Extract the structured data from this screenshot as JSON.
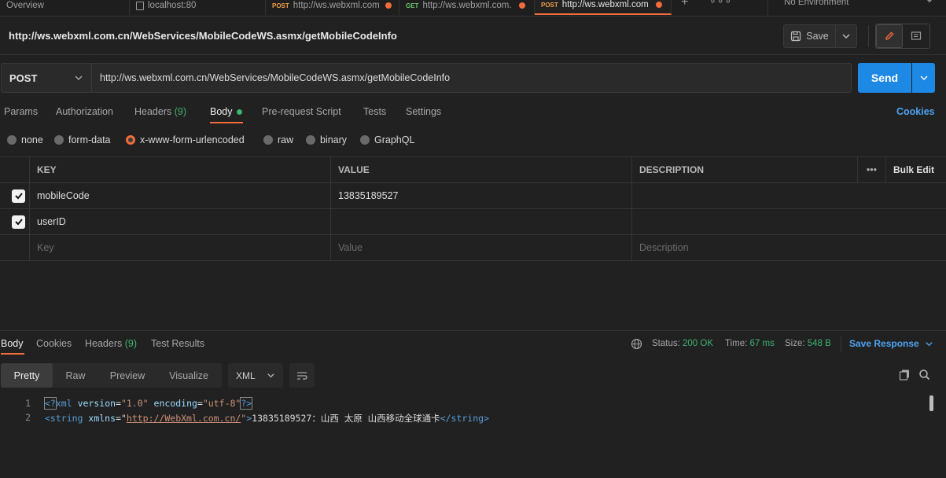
{
  "tabs": [
    {
      "method": "",
      "label": "Overview",
      "dirty": false
    },
    {
      "method": "",
      "label": "localhost:80",
      "dirty": false,
      "icon": "file-icon"
    },
    {
      "method": "POST",
      "label": "http://ws.webxml.com",
      "dirty": true
    },
    {
      "method": "GET",
      "label": "http://ws.webxml.com.",
      "dirty": true
    },
    {
      "method": "POST",
      "label": "http://ws.webxml.com",
      "dirty": true,
      "active": true
    }
  ],
  "tabbar": {
    "environment": "No Environment"
  },
  "request": {
    "title": "http://ws.webxml.com.cn/WebServices/MobileCodeWS.asmx/getMobileCodeInfo",
    "save_label": "Save",
    "method": "POST",
    "url": "http://ws.webxml.com.cn/WebServices/MobileCodeWS.asmx/getMobileCodeInfo",
    "send_label": "Send"
  },
  "request_tabs": {
    "params": "Params",
    "authorization": "Authorization",
    "headers": "Headers",
    "headers_count": "(9)",
    "body": "Body",
    "prerequest": "Pre-request Script",
    "tests": "Tests",
    "settings": "Settings",
    "cookies": "Cookies"
  },
  "body_types": [
    "none",
    "form-data",
    "x-www-form-urlencoded",
    "raw",
    "binary",
    "GraphQL"
  ],
  "body_type_selected": "x-www-form-urlencoded",
  "table": {
    "headers": {
      "key": "KEY",
      "value": "VALUE",
      "description": "DESCRIPTION",
      "bulk_edit": "Bulk Edit"
    },
    "rows": [
      {
        "checked": true,
        "key": "mobileCode",
        "value": "13835189527",
        "description": ""
      },
      {
        "checked": true,
        "key": "userID",
        "value": "",
        "description": ""
      }
    ],
    "placeholders": {
      "key": "Key",
      "value": "Value",
      "description": "Description"
    }
  },
  "response": {
    "tabs": {
      "body": "Body",
      "cookies": "Cookies",
      "headers": "Headers",
      "headers_count": "(9)",
      "test_results": "Test Results"
    },
    "status_label": "Status:",
    "status_value": "200 OK",
    "time_label": "Time:",
    "time_value": "67 ms",
    "size_label": "Size:",
    "size_value": "548 B",
    "save_response": "Save Response",
    "view_modes": [
      "Pretty",
      "Raw",
      "Preview",
      "Visualize"
    ],
    "format": "XML",
    "lines": [
      {
        "n": "1"
      },
      {
        "n": "2"
      }
    ],
    "xml": {
      "decl_open": "<?",
      "decl_name": "xml",
      "decl_attr1": "version",
      "decl_val1": "\"1.0\"",
      "decl_attr2": "encoding",
      "decl_val2": "\"utf-8\"",
      "decl_close": "?>",
      "tag_open": "<string",
      "xmlns_attr": "xmlns",
      "xmlns_val": "http://WebXml.com.cn/",
      "tag_gt": ">",
      "text": "13835189527：山西 太原 山西移动全球通卡",
      "tag_close": "</string>"
    }
  },
  "colors": {
    "accent": "#f26b3a",
    "primary": "#1e88e5",
    "success": "#3cb371",
    "link": "#4ea3f1"
  }
}
